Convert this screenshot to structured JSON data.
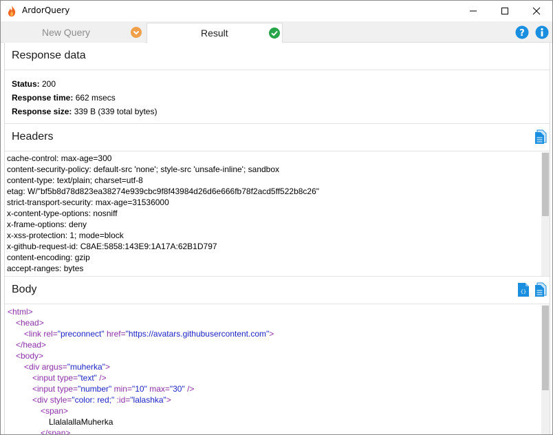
{
  "window": {
    "title": "ArdorQuery",
    "icon": "flame-icon",
    "controls": [
      "minimize",
      "maximize",
      "close"
    ]
  },
  "tabs": [
    {
      "label": "New Query",
      "icon": "chevron-down-circle-icon",
      "icon_color": "#f0a04b",
      "active": false
    },
    {
      "label": "Result",
      "icon": "check-circle-icon",
      "icon_color": "#27a54a",
      "active": true
    }
  ],
  "toolbar": {
    "help_icon": "help-circle-icon",
    "info_icon": "info-circle-icon",
    "accent": "#1a8fe0"
  },
  "response": {
    "title": "Response data",
    "status_label": "Status:",
    "status_value": " 200",
    "time_label": "Response time:",
    "time_value": " 662 msecs",
    "size_label": "Response size:",
    "size_value": " 339 B (339 total bytes)"
  },
  "headers": {
    "title": "Headers",
    "copy_icon": "copy-document-icon",
    "lines": [
      "cache-control: max-age=300",
      "content-security-policy: default-src 'none'; style-src 'unsafe-inline'; sandbox",
      "content-type: text/plain; charset=utf-8",
      "etag: W/\"bf5b8d78d823ea38274e939cbc9f8f43984d26d6e666fb78f2acd5ff522b8c26\"",
      "strict-transport-security: max-age=31536000",
      "x-content-type-options: nosniff",
      "x-frame-options: deny",
      "x-xss-protection: 1; mode=block",
      "x-github-request-id: C8AE:5858:143E9:1A17A:62B1D797",
      "content-encoding: gzip",
      "accept-ranges: bytes"
    ]
  },
  "body": {
    "title": "Body",
    "json_icon": "json-file-icon",
    "copy_icon": "copy-document-icon",
    "code": [
      {
        "indent": 0,
        "parts": [
          [
            "tag",
            "<html>"
          ]
        ]
      },
      {
        "indent": 1,
        "parts": [
          [
            "tag",
            "<head>"
          ]
        ]
      },
      {
        "indent": 2,
        "parts": [
          [
            "tag",
            "<link "
          ],
          [
            "attr",
            "rel="
          ],
          [
            "val",
            "\"preconnect\""
          ],
          [
            "attr",
            " href="
          ],
          [
            "val",
            "\"https://avatars.githubusercontent.com\""
          ],
          [
            "tag",
            ">"
          ]
        ]
      },
      {
        "indent": 1,
        "parts": [
          [
            "tag",
            "</head>"
          ]
        ]
      },
      {
        "indent": 1,
        "parts": [
          [
            "tag",
            "<body>"
          ]
        ]
      },
      {
        "indent": 2,
        "parts": [
          [
            "tag",
            "<div "
          ],
          [
            "attr",
            "argus="
          ],
          [
            "val",
            "\"muherka\""
          ],
          [
            "tag",
            ">"
          ]
        ]
      },
      {
        "indent": 3,
        "parts": [
          [
            "tag",
            "<input "
          ],
          [
            "attr",
            "type="
          ],
          [
            "val",
            "\"text\""
          ],
          [
            "tag",
            " />"
          ]
        ]
      },
      {
        "indent": 3,
        "parts": [
          [
            "tag",
            "<input "
          ],
          [
            "attr",
            "type="
          ],
          [
            "val",
            "\"number\""
          ],
          [
            "attr",
            " min="
          ],
          [
            "val",
            "\"10\""
          ],
          [
            "attr",
            " max="
          ],
          [
            "val",
            "\"30\""
          ],
          [
            "tag",
            " />"
          ]
        ]
      },
      {
        "indent": 3,
        "parts": [
          [
            "tag",
            "<div "
          ],
          [
            "attr",
            "style="
          ],
          [
            "val",
            "\"color: red;\""
          ],
          [
            "attr",
            " :id="
          ],
          [
            "val",
            "\"lalashka\""
          ],
          [
            "tag",
            ">"
          ]
        ]
      },
      {
        "indent": 4,
        "parts": [
          [
            "tag",
            "<span>"
          ]
        ]
      },
      {
        "indent": 5,
        "parts": [
          [
            "txt",
            "LlalalallaMuherka"
          ]
        ]
      },
      {
        "indent": 4,
        "parts": [
          [
            "tag",
            "</span>"
          ]
        ]
      }
    ]
  }
}
